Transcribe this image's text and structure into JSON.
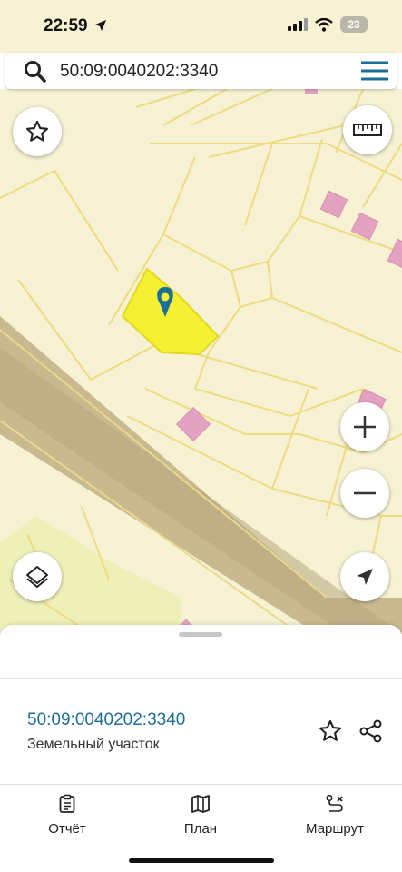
{
  "status_bar": {
    "time": "22:59",
    "battery": "23"
  },
  "search": {
    "value": "50:09:0040202:3340"
  },
  "map": {
    "buttons": {
      "favorite": "star-icon",
      "ruler": "ruler-icon",
      "zoom_in": "plus-icon",
      "zoom_out": "minus-icon",
      "layers": "layers-icon",
      "locate": "navigation-arrow-icon"
    },
    "colors": {
      "background": "#f6f2d3",
      "road": "#c9b98f",
      "selected_parcel": "#f5f032",
      "building": "#e3a2c0",
      "parcel_border": "#eedb80"
    }
  },
  "sheet": {
    "parcel_id": "50:09:0040202:3340",
    "parcel_type": "Земельный участок"
  },
  "nav": [
    {
      "label": "Отчёт",
      "icon": "report-icon"
    },
    {
      "label": "План",
      "icon": "map-icon"
    },
    {
      "label": "Маршрут",
      "icon": "route-icon"
    }
  ]
}
